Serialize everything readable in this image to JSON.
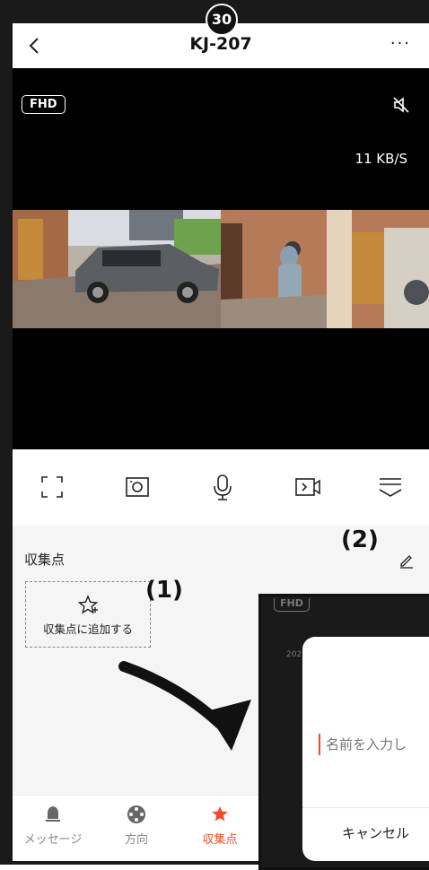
{
  "step_number": "30",
  "header": {
    "title": "KJ-207",
    "back_icon": "chevron-left-icon",
    "more_label": "···"
  },
  "video": {
    "quality_label": "FHD",
    "speed": "11 KB/S",
    "mute_icon": "speaker-mute-icon"
  },
  "controls": [
    {
      "name": "fullscreen-icon"
    },
    {
      "name": "screenshot-icon"
    },
    {
      "name": "microphone-icon"
    },
    {
      "name": "record-icon"
    },
    {
      "name": "more-controls-icon"
    }
  ],
  "favorites": {
    "title": "収集点",
    "add_label": "収集点に追加する",
    "edit_icon": "pencil-icon"
  },
  "annotations": {
    "one": "(1)",
    "two": "(2)"
  },
  "tabs": [
    {
      "label": "メッセージ",
      "icon": "bell-icon",
      "active": false
    },
    {
      "label": "方向",
      "icon": "dpad-icon",
      "active": false
    },
    {
      "label": "収集点",
      "icon": "star-icon",
      "active": true
    }
  ],
  "overlay": {
    "quality_label": "FHD",
    "date_stub": "202",
    "input_placeholder": "名前を入力し",
    "cancel_label": "キャンセル"
  },
  "colors": {
    "accent": "#f04a2a",
    "text": "#222222",
    "muted": "#888888"
  }
}
